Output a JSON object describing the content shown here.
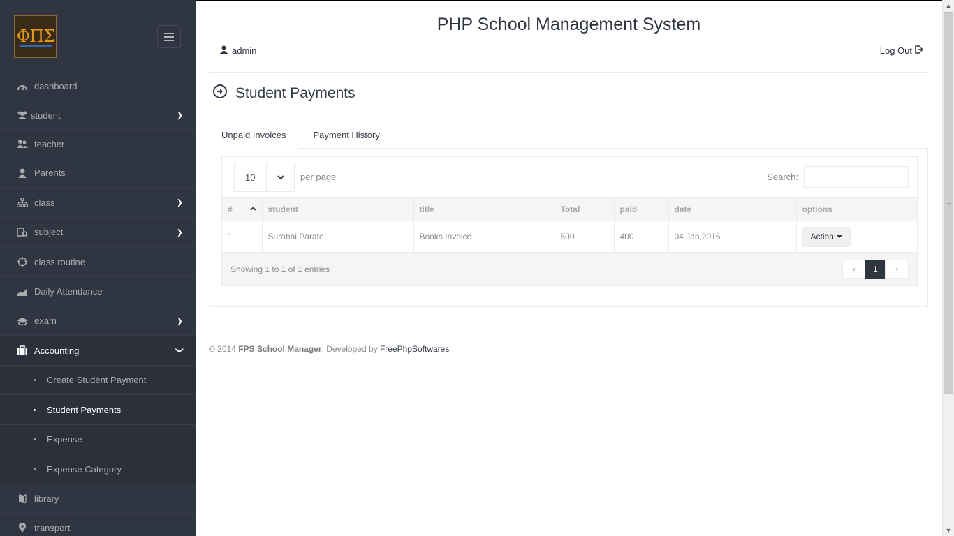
{
  "app": {
    "title": "PHP School Management System"
  },
  "header": {
    "user": "admin",
    "logout": "Log Out"
  },
  "sidebar": {
    "items": [
      {
        "label": "dashboard",
        "icon": "dashboard-icon"
      },
      {
        "label": "student",
        "icon": "users-icon"
      },
      {
        "label": "teacher",
        "icon": "teacher-icon"
      },
      {
        "label": "Parents",
        "icon": "user-icon"
      },
      {
        "label": "class",
        "icon": "flow-tree-icon"
      },
      {
        "label": "subject",
        "icon": "docs-icon"
      },
      {
        "label": "class routine",
        "icon": "target-icon"
      },
      {
        "label": "Daily Attendance",
        "icon": "chart-area-icon"
      },
      {
        "label": "exam",
        "icon": "graduation-cap-icon"
      },
      {
        "label": "Accounting",
        "icon": "suitcase-icon"
      },
      {
        "label": "library",
        "icon": "book-icon"
      },
      {
        "label": "transport",
        "icon": "location-icon"
      }
    ],
    "accounting_sub": [
      {
        "label": "Create Student Payment"
      },
      {
        "label": "Student Payments"
      },
      {
        "label": "Expense"
      },
      {
        "label": "Expense Category"
      }
    ]
  },
  "page": {
    "title": "Student Payments"
  },
  "tabs": {
    "unpaid": "Unpaid Invoices",
    "history": "Payment History"
  },
  "table_controls": {
    "per_page_value": "10",
    "per_page_label": "per page",
    "search_label": "Search:",
    "search_placeholder": ""
  },
  "table": {
    "columns": [
      "#",
      "student",
      "title",
      "Total",
      "paid",
      "date",
      "options"
    ],
    "rows": [
      {
        "num": "1",
        "student": "Surabhi Parate",
        "title": "Books Invoice",
        "total": "500",
        "paid": "400",
        "date": "04 Jan,2016",
        "action": "Action"
      }
    ],
    "info": "Showing 1 to 1 of 1 entries",
    "pager": {
      "prev": "‹",
      "current": "1",
      "next": "›"
    }
  },
  "footer": {
    "prefix": "© 2014 ",
    "product": "FPS School Manager",
    "middle": ". Developed by ",
    "developer": "FreePhpSoftwares"
  },
  "colors": {
    "sidebar_bg": "#303641",
    "accent_dark": "#303641"
  }
}
